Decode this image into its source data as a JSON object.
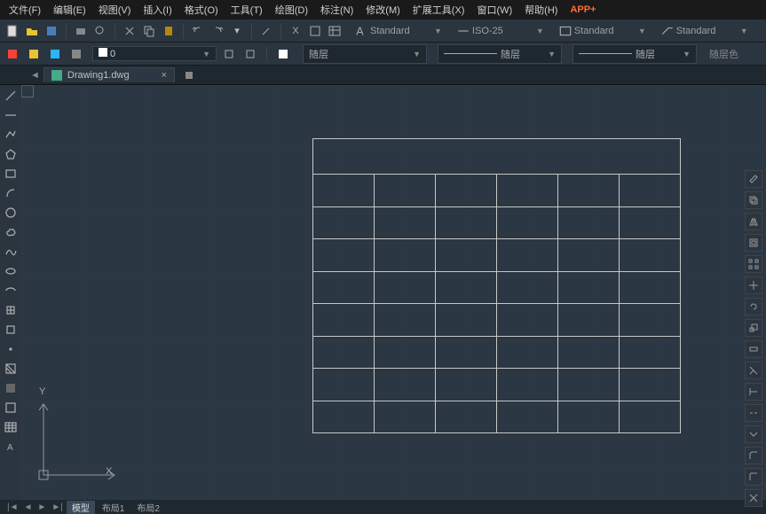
{
  "menu": {
    "file": "文件(F)",
    "edit": "编辑(E)",
    "view": "视图(V)",
    "insert": "插入(I)",
    "format": "格式(O)",
    "tools": "工具(T)",
    "draw": "绘图(D)",
    "dimension": "标注(N)",
    "modify": "修改(M)",
    "extensions": "扩展工具(X)",
    "window": "窗口(W)",
    "help": "帮助(H)",
    "appplus": "APP+"
  },
  "styles": {
    "text_style": "Standard",
    "dim_style": "ISO-25",
    "table_style": "Standard",
    "mleader_style": "Standard"
  },
  "layer": {
    "current": "0"
  },
  "linetype": {
    "label1": "随层",
    "label2": "随层",
    "byblock": "随层色"
  },
  "tab": {
    "filename": "Drawing1.dwg"
  },
  "canvas": {
    "table": {
      "rows": 8,
      "cols": 6
    },
    "ucs": {
      "x": "X",
      "y": "Y"
    }
  },
  "statusbar": {
    "model": "模型",
    "layout1": "布局1",
    "layout2": "布局2"
  }
}
